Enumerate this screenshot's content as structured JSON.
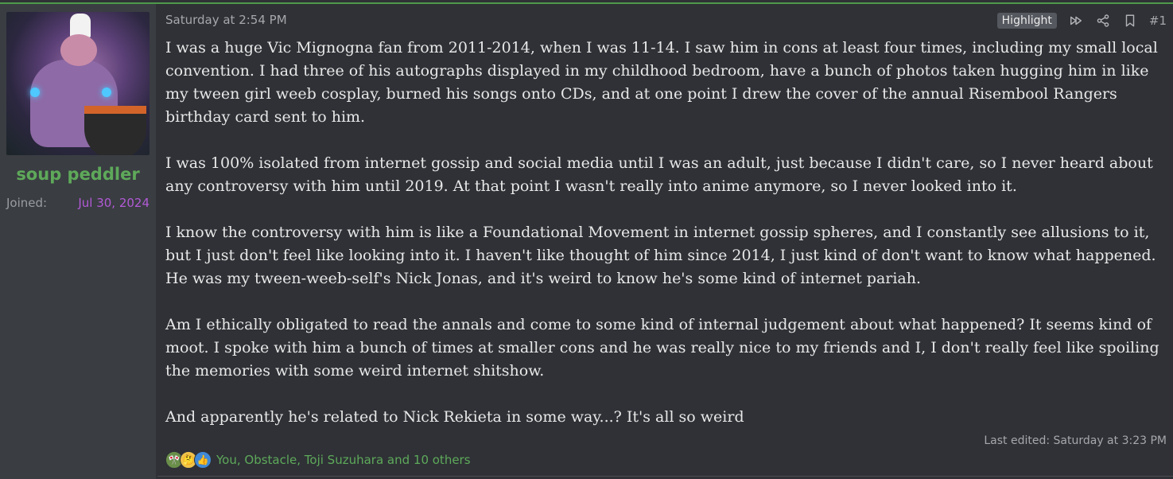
{
  "user": {
    "name": "soup peddler",
    "joined_label": "Joined:",
    "joined_value": "Jul 30, 2024",
    "avatar_icon": "chef-avatar-icon"
  },
  "post": {
    "date": "Saturday at 2:54 PM",
    "highlight_label": "Highlight",
    "number": "#1",
    "paragraphs": [
      "I was a huge Vic Mignogna fan from 2011-2014, when I was 11-14. I saw him in cons at least four times, including my small local convention. I had three of his autographs displayed in my childhood bedroom, have a bunch of photos taken hugging him in like my tween girl weeb cosplay, burned his songs onto CDs, and at one point I drew the cover of the annual Risembool Rangers birthday card sent to him.",
      "I was 100% isolated from internet gossip and social media until I was an adult, just because I didn't care, so I never heard about any controversy with him until 2019. At that point I wasn't really into anime anymore, so I never looked into it.",
      "I know the controversy with him is like a Foundational Movement in internet gossip spheres, and I constantly see allusions to it, but I just don't feel like looking into it. I haven't like thought of him since 2014, I just kind of don't want to know what happened. He was my tween-weeb-self's Nick Jonas, and it's weird to know he's some kind of internet pariah.",
      "Am I ethically obligated to read the annals and come to some kind of internal judgement about what happened? It seems kind of moot. I spoke with him a bunch of times at smaller cons and he was really nice to my friends and I, I don't really feel like spoiling the memories with some weird internet shitshow.",
      "And apparently he's related to Nick Rekieta in some way...? It's all so weird"
    ],
    "last_edited": "Last edited: Saturday at 3:23 PM",
    "reactions_text": "You, Obstacle, Toji Suzuhara and 10 others"
  },
  "colors": {
    "background": "#2f3136",
    "sidebar": "#3a3d42",
    "username": "#5ea95a",
    "joined_date": "#b25ad6",
    "accent_rule": "#4e9a4a"
  }
}
